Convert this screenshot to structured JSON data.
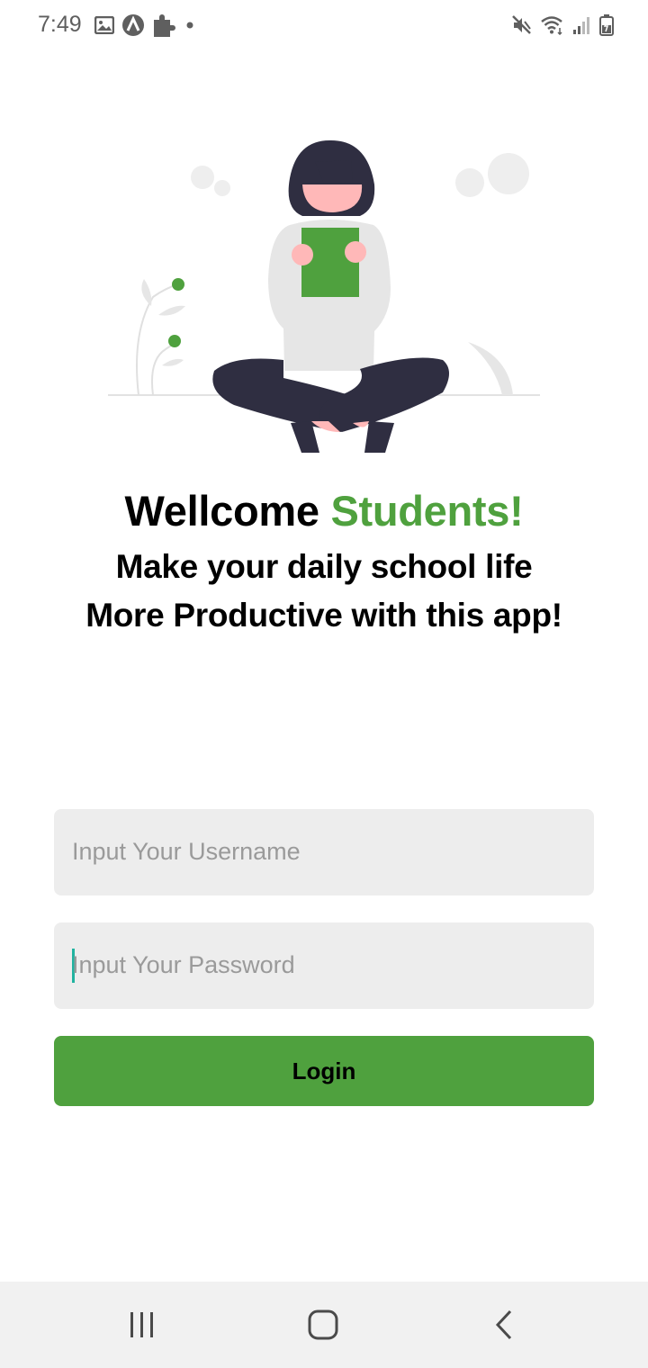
{
  "status_bar": {
    "time": "7:49",
    "left_icons": [
      "image-icon",
      "app-a-icon",
      "puzzle-icon",
      "dot-icon"
    ],
    "right_icons": [
      "mute-icon",
      "wifi-icon",
      "signal-icon",
      "battery-icon"
    ]
  },
  "welcome": {
    "prefix": "Wellcome ",
    "accent": "Students!",
    "accent_color": "#4fa13e"
  },
  "tagline": {
    "line1": "Make your daily school life",
    "line2": "More Productive with this app!"
  },
  "form": {
    "username": {
      "value": "",
      "placeholder": "Input Your Username"
    },
    "password": {
      "value": "",
      "placeholder": "Input Your Password",
      "focused": true
    },
    "login_label": "Login",
    "button_color": "#4fa13e"
  },
  "nav_bar": {
    "buttons": [
      "recent-apps-icon",
      "home-icon",
      "back-icon"
    ]
  }
}
